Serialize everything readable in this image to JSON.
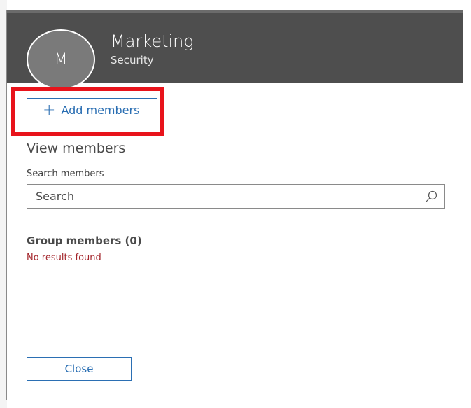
{
  "header": {
    "avatar_initial": "M",
    "group_name": "Marketing",
    "group_type": "Security"
  },
  "actions": {
    "add_members_label": "Add members"
  },
  "view_members": {
    "heading": "View members",
    "search_label": "Search members",
    "search_placeholder": "Search",
    "search_value": ""
  },
  "group_members": {
    "heading": "Group members (0)",
    "empty_message": "No results found"
  },
  "footer": {
    "close_label": "Close"
  },
  "colors": {
    "header_bg": "#4e4e4e",
    "accent": "#2b6fb3",
    "error": "#a4262c",
    "highlight": "#e8131b"
  },
  "icons": {
    "add": "plus-icon",
    "search": "search-icon"
  }
}
